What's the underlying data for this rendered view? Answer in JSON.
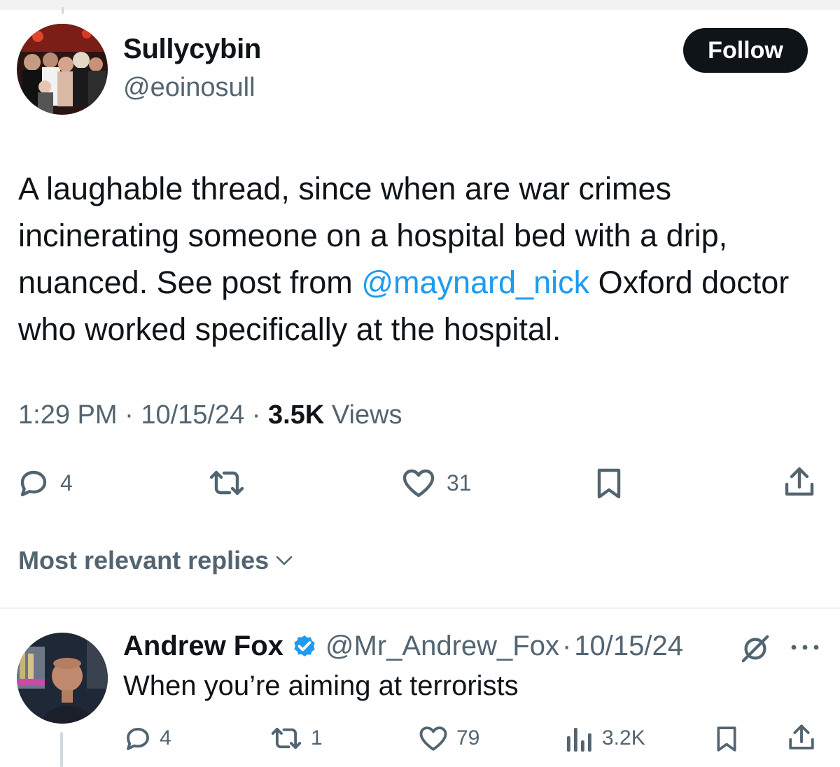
{
  "tweet": {
    "author": {
      "display_name": "Sullycybin",
      "handle": "@eoinosull"
    },
    "follow_label": "Follow",
    "text_before": "A laughable thread, since when are war crimes incinerating someone on a hospital bed with a drip, nuanced. See post from ",
    "mention": "@maynard_nick",
    "text_after": " Oxford doctor who worked specifically at the hospital.",
    "time": "1:29 PM",
    "date": "10/15/24",
    "views_count": "3.5K",
    "views_label": "Views",
    "separator": "·",
    "actions": {
      "reply_count": "4",
      "retweet_count": "",
      "like_count": "31"
    }
  },
  "replies_sort_label": "Most relevant replies",
  "reply": {
    "display_name": "Andrew Fox",
    "handle": "@Mr_Andrew_Fox",
    "separator": "·",
    "date": "10/15/24",
    "text": "When you’re aiming at terrorists",
    "actions": {
      "reply_count": "4",
      "retweet_count": "1",
      "like_count": "79",
      "views_count": "3.2K"
    }
  },
  "colors": {
    "text_primary": "#0f1419",
    "text_secondary": "#536471",
    "accent": "#1d9bf0",
    "follow_bg": "#0f1419"
  },
  "icons": {
    "reply": "speech-bubble-icon",
    "retweet": "retweet-icon",
    "like": "heart-icon",
    "bookmark": "bookmark-icon",
    "share": "share-icon",
    "views": "bar-chart-icon",
    "verified": "verified-badge-icon",
    "grok": "grok-icon",
    "more": "more-dots-icon",
    "sort": "chevron-down-icon"
  }
}
